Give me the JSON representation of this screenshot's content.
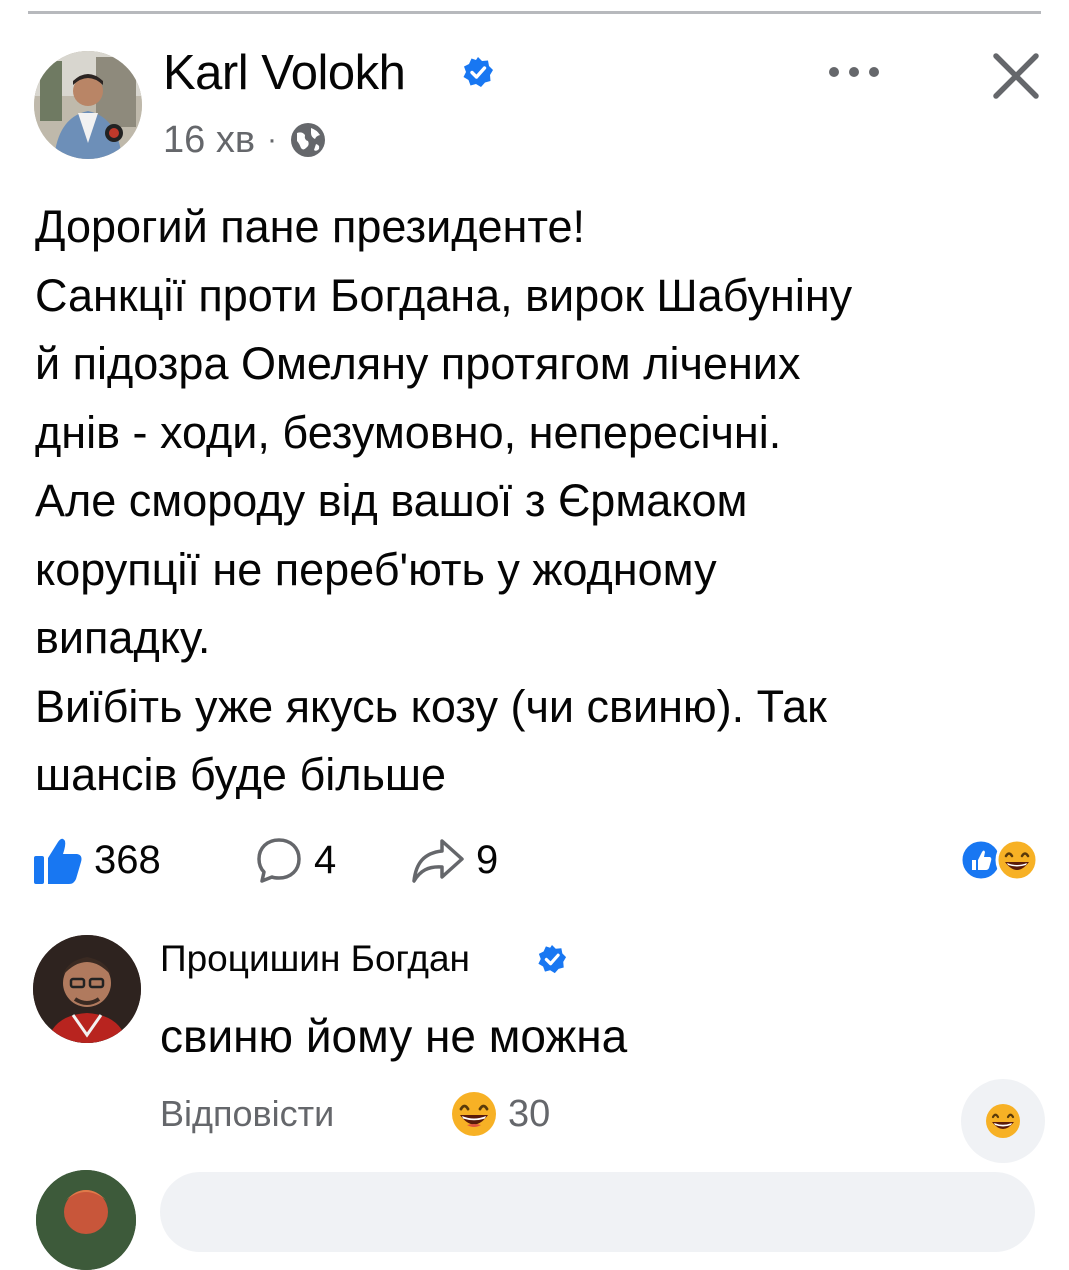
{
  "post": {
    "author": "Karl Volokh",
    "time": "16 хв",
    "meta_separator": "·",
    "body_lines": [
      "Дорогий пане президенте!",
      "Санкції проти Богдана, вирок Шабуніну",
      "й підозра Омеляну протягом лічених",
      "днів - ходи, безумовно, непересічні.",
      "Але смороду від вашої з Єрмаком",
      "корупції не переб'ють у жодному",
      "випадку.",
      "Виїбіть уже якусь козу (чи свиню). Так",
      "шансів буде більше"
    ]
  },
  "stats": {
    "likes": "368",
    "comments": "4",
    "shares": "9"
  },
  "comment": {
    "author": "Процишин Богдан",
    "text": "свиню йому не можна",
    "reply_label": "Відповісти",
    "reaction_count": "30"
  },
  "icons": {
    "verified": "verified-badge-icon",
    "privacy": "globe-icon",
    "more": "more-dots-icon",
    "close": "close-icon",
    "like": "thumbs-up-icon",
    "comment": "comment-bubble-icon",
    "share": "share-arrow-icon",
    "reaction": "laughing-emoji-icon"
  },
  "colors": {
    "accent": "#1877f2",
    "secondary_text": "#65676b",
    "emoji_yellow": "#f7b125"
  }
}
